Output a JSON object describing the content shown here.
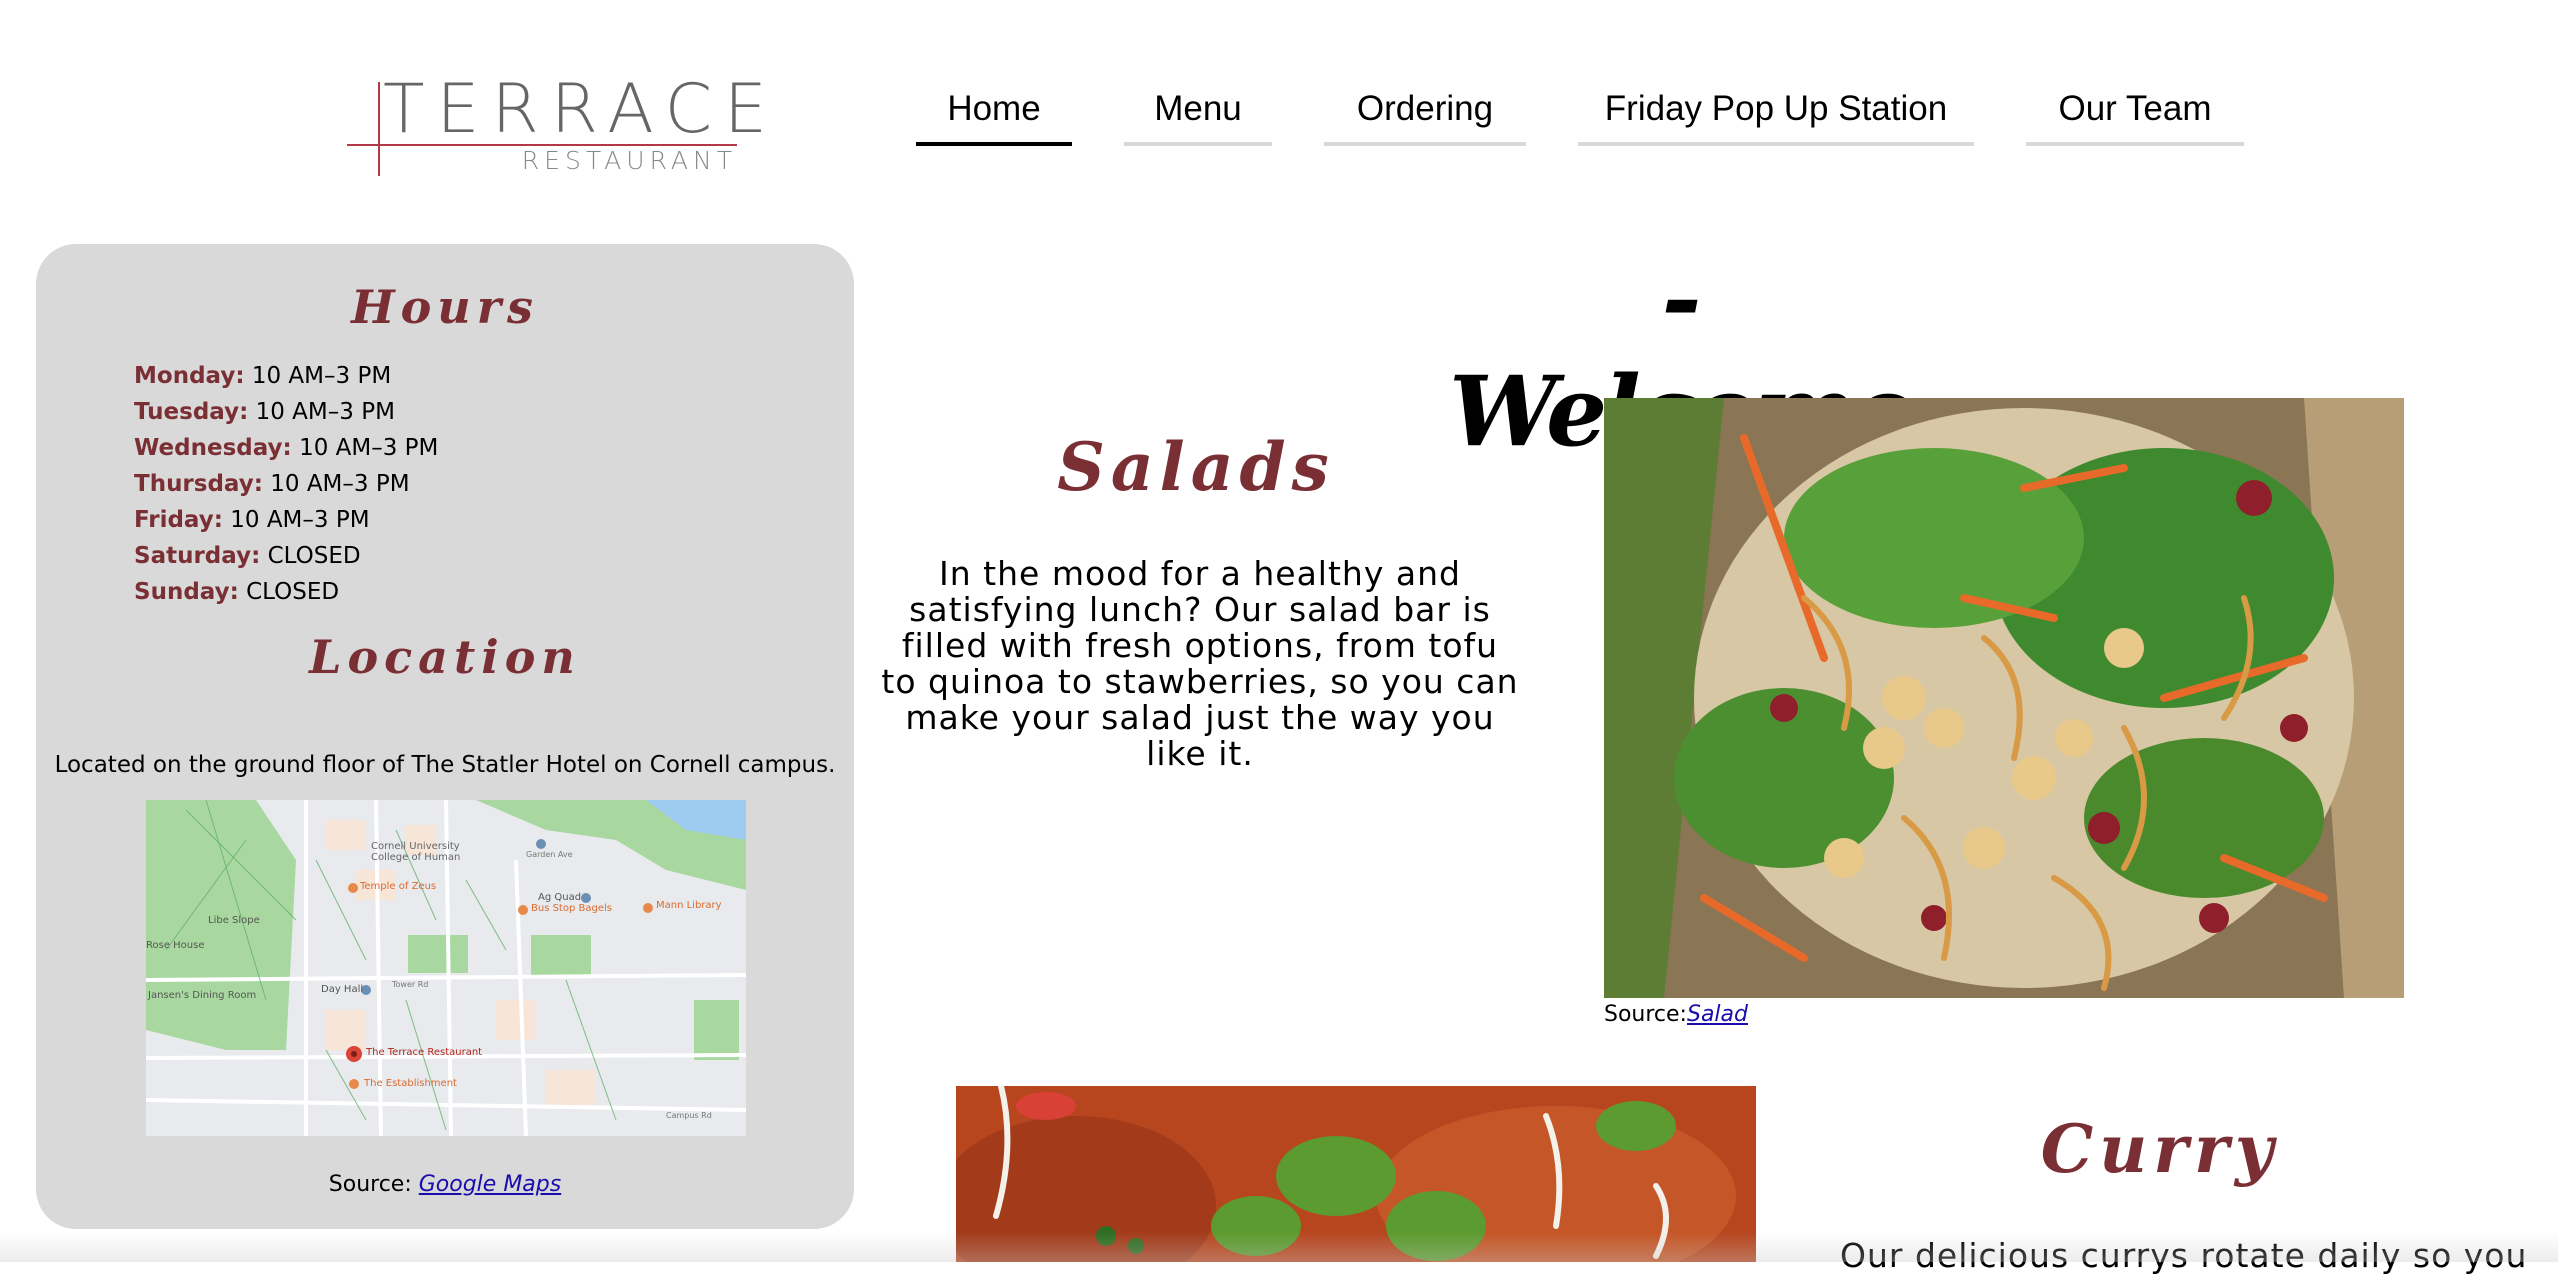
{
  "logo": {
    "word": "TERRACE",
    "sub": "RESTAURANT"
  },
  "nav": [
    {
      "label": "Home",
      "active": true
    },
    {
      "label": "Menu",
      "active": false
    },
    {
      "label": "Ordering",
      "active": false
    },
    {
      "label": "Friday Pop Up Station",
      "active": false
    },
    {
      "label": "Our Team",
      "active": false
    }
  ],
  "sidebar": {
    "hours_title": "Hours",
    "hours": [
      {
        "day": "Monday:",
        "time": "10 AM–3 PM"
      },
      {
        "day": "Tuesday:",
        "time": "10 AM–3 PM"
      },
      {
        "day": "Wednesday:",
        "time": "10 AM–3 PM"
      },
      {
        "day": "Thursday:",
        "time": "10 AM–3 PM"
      },
      {
        "day": "Friday:",
        "time": "10 AM–3 PM"
      },
      {
        "day": "Saturday:",
        "time": "CLOSED"
      },
      {
        "day": "Sunday:",
        "time": "CLOSED"
      }
    ],
    "location_title": "Location",
    "location_text": "Located on the ground floor of The Statler Hotel on Cornell campus.",
    "map_labels": {
      "cornell": "Cornell University College of Human",
      "temple": "Temple of Zeus",
      "agquad": "Ag Quad",
      "mann": "Mann Library",
      "busstop": "Bus Stop Bagels",
      "libe": "Libe Slope",
      "rose": "Rose House",
      "jansen": "Jansen's Dining Room",
      "dayhall": "Day Hall",
      "terrace": "The Terrace Restaurant",
      "establishment": "The Establishment",
      "tower": "Tower Rd",
      "campus": "Campus Rd",
      "garden": "Garden Ave"
    },
    "source_prefix": "Source: ",
    "source_link": "Google Maps"
  },
  "main": {
    "welcome": "- Welcome -",
    "salads_title": "Salads",
    "salads_desc": "In the mood for a healthy and satisfying lunch? Our salad bar is filled with fresh options, from tofu to quinoa to stawberries, so you can make your salad just the way you like it.",
    "salad_source_prefix": "Source:",
    "salad_source_link": "Salad",
    "curry_title": "Curry",
    "curry_desc": "Our delicious currys rotate daily so you"
  },
  "colors": {
    "accent": "#7a2f35",
    "sidebar_bg": "#d9d9d9",
    "logo_line": "#b23a48"
  }
}
